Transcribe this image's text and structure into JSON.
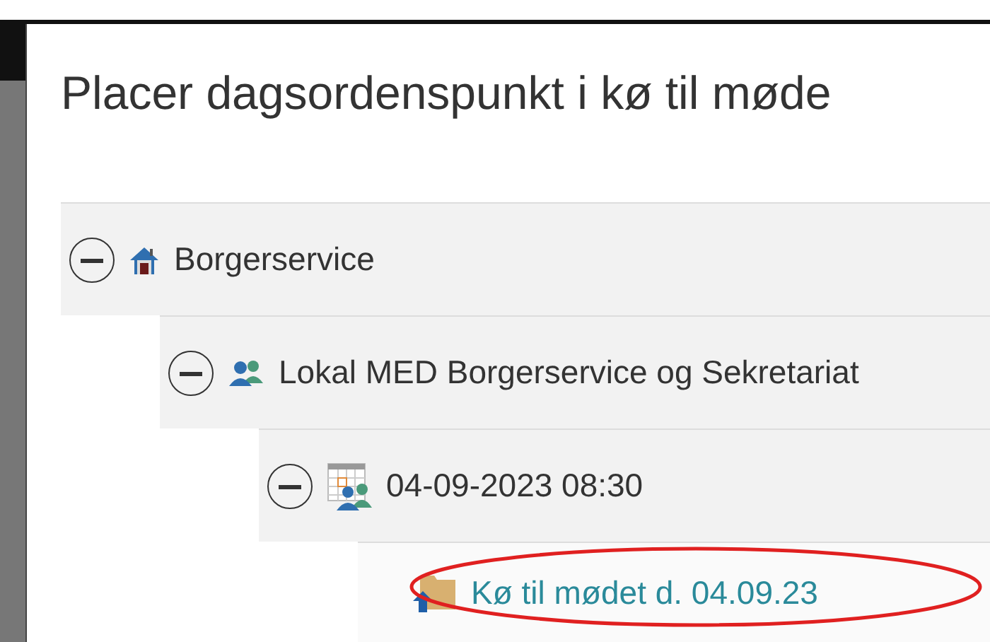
{
  "dialog": {
    "title": "Placer dagsordenspunkt i kø til møde"
  },
  "tree": [
    {
      "label": "Borgerservice",
      "kind": "home",
      "expanded": true,
      "selected": false,
      "children": [
        {
          "label": "Lokal MED Borgerservice og Sekretariat",
          "kind": "group",
          "expanded": true,
          "selected": false,
          "children": [
            {
              "label": "04-09-2023 08:30",
              "kind": "meeting",
              "expanded": true,
              "selected": false,
              "children": [
                {
                  "label": "Kø til mødet d. 04.09.23",
                  "kind": "folder",
                  "selected": true,
                  "circled": true
                }
              ]
            }
          ]
        }
      ]
    }
  ]
}
